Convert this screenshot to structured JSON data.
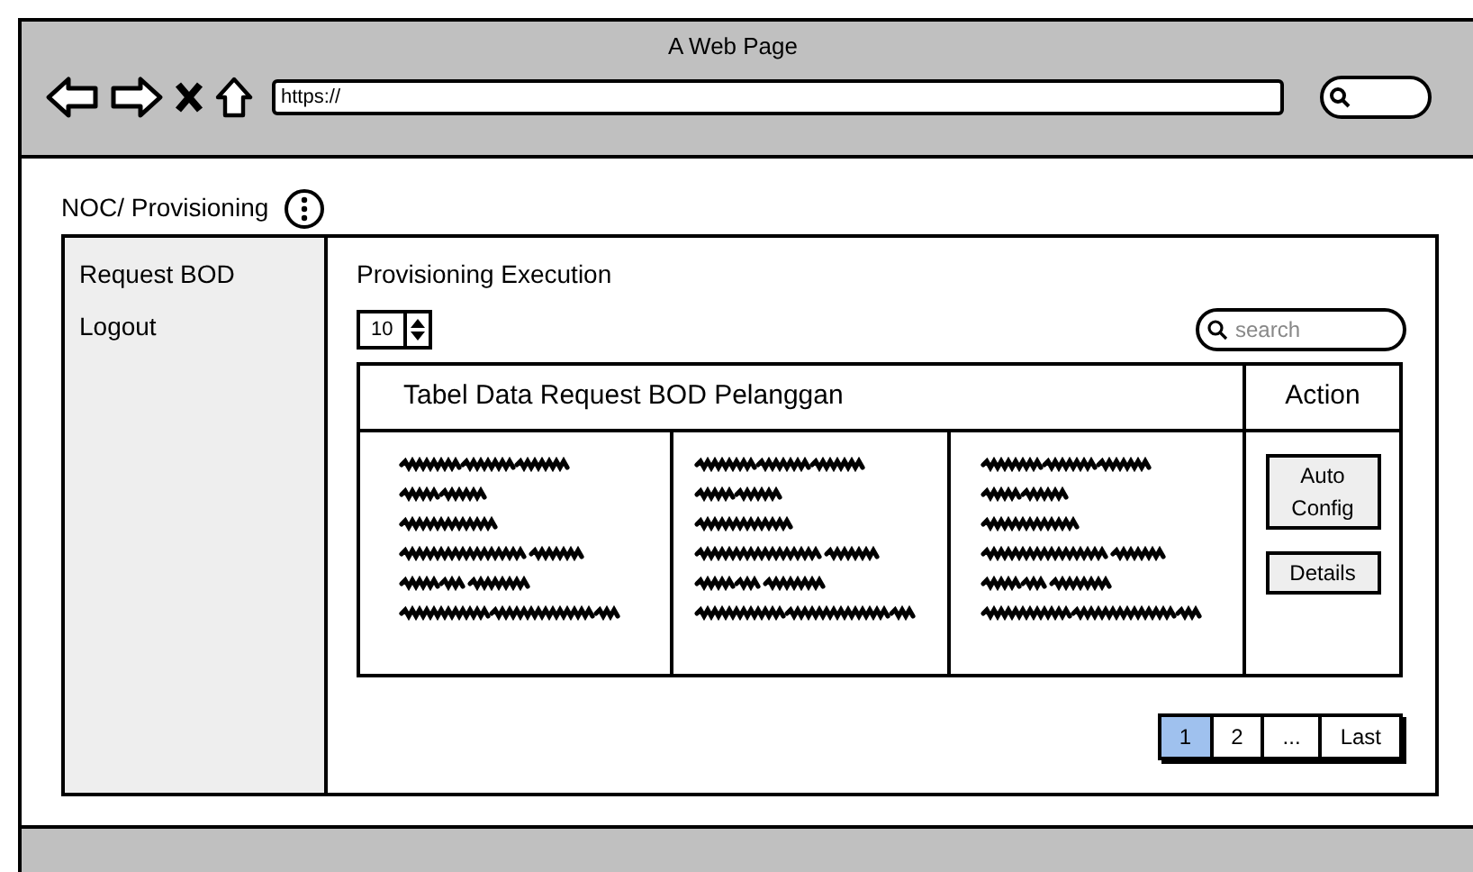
{
  "window": {
    "title": "A Web Page",
    "url": "https://"
  },
  "page_title": "NOC/ Provisioning",
  "sidebar": {
    "items": [
      {
        "label": "Request BOD"
      },
      {
        "label": "Logout"
      }
    ]
  },
  "main": {
    "heading": "Provisioning Execution",
    "page_size": "10",
    "search": {
      "placeholder": "search"
    },
    "table": {
      "title": "Tabel Data Request BOD Pelanggan",
      "action_header": "Action",
      "actions": [
        "Auto Config",
        "Details"
      ]
    },
    "pagination": [
      {
        "label": "1",
        "selected": true
      },
      {
        "label": "2",
        "selected": false
      },
      {
        "label": "...",
        "selected": false
      },
      {
        "label": "Last",
        "selected": false
      }
    ]
  }
}
